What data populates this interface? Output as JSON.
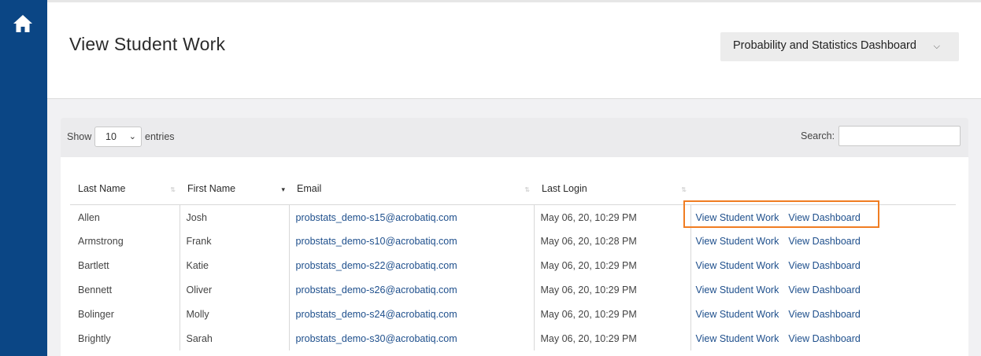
{
  "page": {
    "title": "View Student Work",
    "dashboard_select": {
      "value": "Probability and Statistics Dashboard"
    }
  },
  "colors": {
    "sidebar": "#0b4685",
    "link": "#1e4f8c",
    "highlight": "#f07d22"
  },
  "icons": {
    "home": "home-icon",
    "dropdown": "chevron-down-icon"
  },
  "table_controls": {
    "show_label": "Show",
    "entries_value": "10",
    "entries_label": "entries",
    "search_label": "Search:",
    "search_value": ""
  },
  "table": {
    "columns": [
      "Last Name",
      "First Name",
      "Email",
      "Last Login",
      ""
    ],
    "rows": [
      {
        "last": "Allen",
        "first": "Josh",
        "email": "probstats_demo-s15@acrobatiq.com",
        "login": "May 06, 20, 10:29 PM",
        "action1": "View Student Work",
        "action2": "View Dashboard"
      },
      {
        "last": "Armstrong",
        "first": "Frank",
        "email": "probstats_demo-s10@acrobatiq.com",
        "login": "May 06, 20, 10:28 PM",
        "action1": "View Student Work",
        "action2": "View Dashboard"
      },
      {
        "last": "Bartlett",
        "first": "Katie",
        "email": "probstats_demo-s22@acrobatiq.com",
        "login": "May 06, 20, 10:29 PM",
        "action1": "View Student Work",
        "action2": "View Dashboard"
      },
      {
        "last": "Bennett",
        "first": "Oliver",
        "email": "probstats_demo-s26@acrobatiq.com",
        "login": "May 06, 20, 10:29 PM",
        "action1": "View Student Work",
        "action2": "View Dashboard"
      },
      {
        "last": "Bolinger",
        "first": "Molly",
        "email": "probstats_demo-s24@acrobatiq.com",
        "login": "May 06, 20, 10:29 PM",
        "action1": "View Student Work",
        "action2": "View Dashboard"
      },
      {
        "last": "Brightly",
        "first": "Sarah",
        "email": "probstats_demo-s30@acrobatiq.com",
        "login": "May 06, 20, 10:29 PM",
        "action1": "View Student Work",
        "action2": "View Dashboard"
      }
    ]
  }
}
